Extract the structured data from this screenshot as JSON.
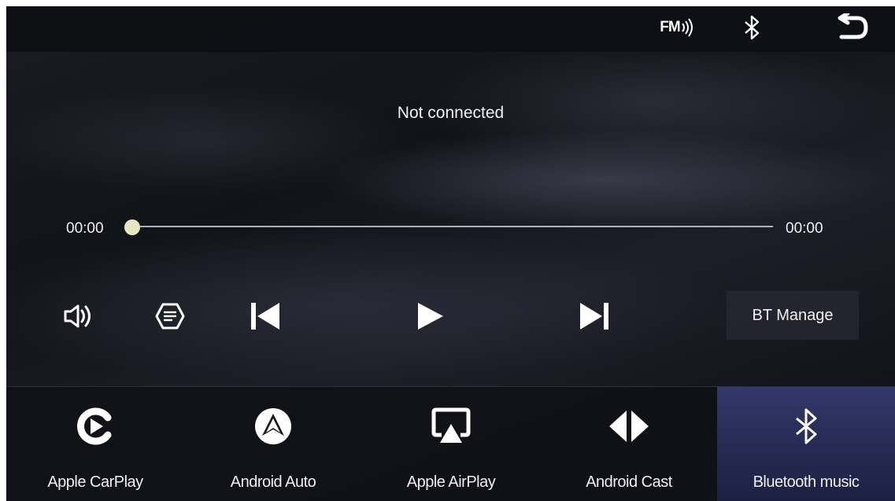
{
  "topbar": {
    "fm_label": "FM",
    "icons": [
      "fm-radio-icon",
      "bluetooth-icon",
      "back-arrow-icon"
    ]
  },
  "player": {
    "status": "Not connected",
    "time_elapsed": "00:00",
    "time_total": "00:00",
    "progress": 0,
    "controls": [
      "volume-icon",
      "playlist-icon",
      "previous-track-icon",
      "play-icon",
      "next-track-icon"
    ],
    "bt_manage_label": "BT Manage"
  },
  "tabs": [
    {
      "label": "Apple CarPlay",
      "icon": "carplay-icon"
    },
    {
      "label": "Android Auto",
      "icon": "android-auto-icon"
    },
    {
      "label": "Apple AirPlay",
      "icon": "airplay-icon"
    },
    {
      "label": "Android Cast",
      "icon": "android-cast-icon"
    },
    {
      "label": "Bluetooth music",
      "icon": "bluetooth-icon"
    }
  ],
  "active_tab": "Bluetooth music",
  "colors": {
    "background": "#121319",
    "active_tab": "#2a2f5e",
    "progress_knob": "#e9e6c2",
    "text": "#f2f2f2"
  }
}
